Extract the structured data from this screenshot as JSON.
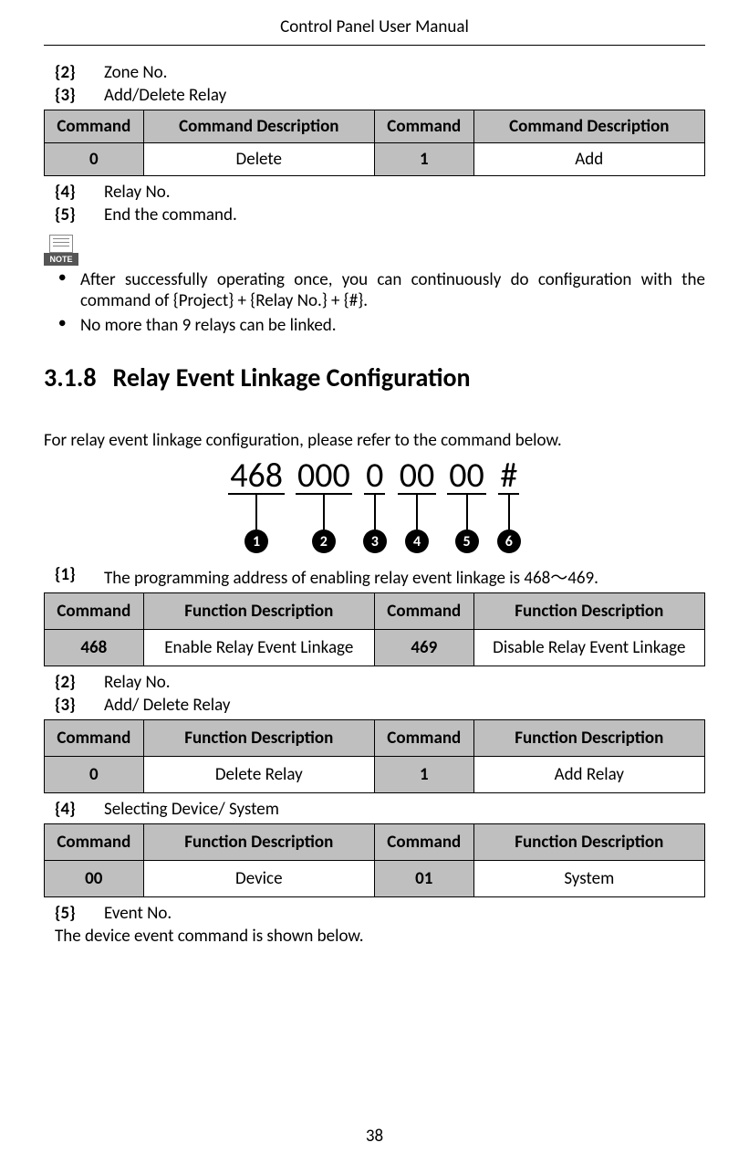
{
  "header": {
    "title": "Control Panel User Manual"
  },
  "defs_top": [
    {
      "key": "{2}",
      "text": "Zone No."
    },
    {
      "key": "{3}",
      "text": "Add/Delete Relay"
    }
  ],
  "table1": {
    "headers": [
      "Command",
      "Command Description",
      "Command",
      "Command Description"
    ],
    "rows": [
      [
        "0",
        "Delete",
        "1",
        "Add"
      ]
    ]
  },
  "defs_mid": [
    {
      "key": "{4}",
      "text": "Relay No."
    },
    {
      "key": "{5}",
      "text": "End the command."
    }
  ],
  "note_icon_label": "NOTE",
  "notes": [
    "After successfully operating once, you can continuously do configuration with the command of {Project} + {Relay No.} + {#}.",
    "No more than 9 relays can be linked."
  ],
  "section": {
    "number": "3.1.8",
    "title": "Relay Event Linkage Configuration"
  },
  "intro": "For relay event linkage configuration, please refer to the command below.",
  "diagram": {
    "segments": [
      "468",
      "000",
      "0",
      "00",
      "00",
      "#"
    ],
    "labels": [
      "1",
      "2",
      "3",
      "4",
      "5",
      "6"
    ]
  },
  "def_1": {
    "key": "{1}",
    "text": "The programming address of enabling relay event linkage is 468～469."
  },
  "table2": {
    "headers": [
      "Command",
      "Function Description",
      "Command",
      "Function Description"
    ],
    "rows": [
      [
        "468",
        "Enable Relay Event Linkage",
        "469",
        "Disable Relay Event Linkage"
      ]
    ]
  },
  "defs_23": [
    {
      "key": "{2}",
      "text": "Relay No."
    },
    {
      "key": "{3}",
      "text": "Add/ Delete Relay"
    }
  ],
  "table3": {
    "headers": [
      "Command",
      "Function Description",
      "Command",
      "Function Description"
    ],
    "rows": [
      [
        "0",
        "Delete Relay",
        "1",
        "Add Relay"
      ]
    ]
  },
  "def_4": {
    "key": "{4}",
    "text": "Selecting Device/ System"
  },
  "table4": {
    "headers": [
      "Command",
      "Function Description",
      "Command",
      "Function Description"
    ],
    "rows": [
      [
        "00",
        "Device",
        "01",
        "System"
      ]
    ]
  },
  "def_5": {
    "key": "{5}",
    "text": "Event No."
  },
  "tail": "The device event command is shown below.",
  "pagenum": "38"
}
